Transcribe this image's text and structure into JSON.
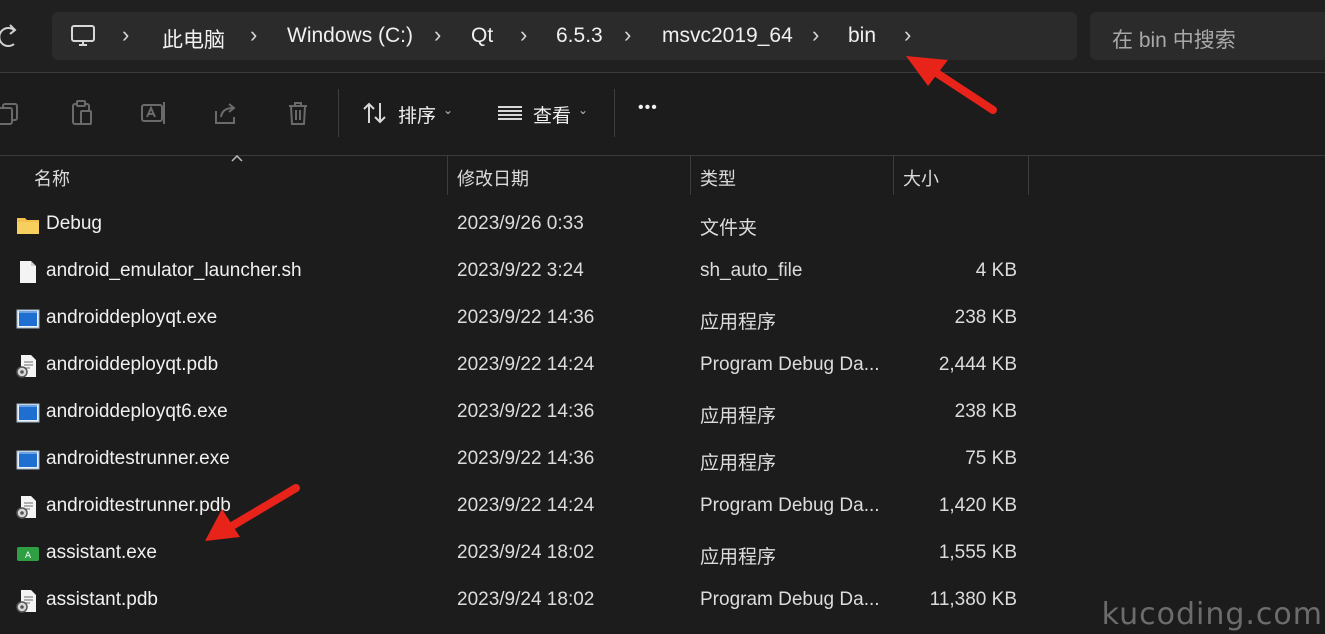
{
  "breadcrumb": {
    "items": [
      "此电脑",
      "Windows (C:)",
      "Qt",
      "6.5.3",
      "msvc2019_64",
      "bin"
    ],
    "separator": "›"
  },
  "search": {
    "placeholder": "在 bin 中搜索"
  },
  "toolbar": {
    "sort_label": "排序",
    "view_label": "查看",
    "more_label": "•••"
  },
  "columns": {
    "name": "名称",
    "date": "修改日期",
    "type": "类型",
    "size": "大小"
  },
  "files": [
    {
      "name": "Debug",
      "date": "2023/9/26 0:33",
      "type": "文件夹",
      "size": "",
      "icon": "folder-icon"
    },
    {
      "name": "android_emulator_launcher.sh",
      "date": "2023/9/22 3:24",
      "type": "sh_auto_file",
      "size": "4 KB",
      "icon": "file-icon"
    },
    {
      "name": "androiddeployqt.exe",
      "date": "2023/9/22 14:36",
      "type": "应用程序",
      "size": "238 KB",
      "icon": "exe-icon"
    },
    {
      "name": "androiddeployqt.pdb",
      "date": "2023/9/22 14:24",
      "type": "Program Debug Da...",
      "size": "2,444 KB",
      "icon": "pdb-icon"
    },
    {
      "name": "androiddeployqt6.exe",
      "date": "2023/9/22 14:36",
      "type": "应用程序",
      "size": "238 KB",
      "icon": "exe-icon"
    },
    {
      "name": "androidtestrunner.exe",
      "date": "2023/9/22 14:36",
      "type": "应用程序",
      "size": "75 KB",
      "icon": "exe-icon"
    },
    {
      "name": "androidtestrunner.pdb",
      "date": "2023/9/22 14:24",
      "type": "Program Debug Da...",
      "size": "1,420 KB",
      "icon": "pdb-icon"
    },
    {
      "name": "assistant.exe",
      "date": "2023/9/24 18:02",
      "type": "应用程序",
      "size": "1,555 KB",
      "icon": "assistant-icon"
    },
    {
      "name": "assistant.pdb",
      "date": "2023/9/24 18:02",
      "type": "Program Debug Da...",
      "size": "11,380 KB",
      "icon": "pdb-icon"
    }
  ],
  "watermark": "kucoding.com",
  "colors": {
    "background": "#1c1c1c",
    "address_bar": "#2b2b2b",
    "annotation_arrow": "#e8231a",
    "folder": "#f4c04d"
  }
}
